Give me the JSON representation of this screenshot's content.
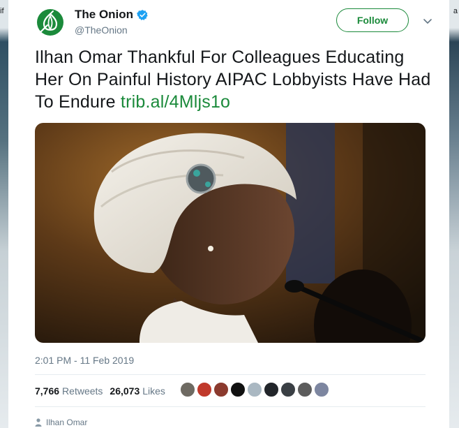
{
  "background": {
    "left_text": "if",
    "right_text": "a"
  },
  "tweet": {
    "display_name": "The Onion",
    "handle": "@TheOnion",
    "follow_label": "Follow",
    "text": "Ilhan Omar Thankful For Colleagues Educating Her On Painful History AIPAC Lobbyists Have Had To Endure",
    "link": "trib.al/4Mljs1o",
    "timestamp": "2:01 PM - 11 Feb 2019",
    "retweets_count": "7,766",
    "retweets_label": "Retweets",
    "likes_count": "26,073",
    "likes_label": "Likes",
    "mentioned_user": "Ilhan Omar"
  },
  "colors": {
    "brand_green": "#1b8a3b",
    "verified_blue": "#1da1f2",
    "text_primary": "#14171a",
    "text_secondary": "#657786"
  },
  "icons": [
    "onion-logo-icon",
    "verified-badge-icon",
    "chevron-down-icon",
    "person-icon"
  ],
  "liker_avatars": [
    {
      "name": "liker-avatar-1",
      "color": "#6e6a62"
    },
    {
      "name": "liker-avatar-2",
      "color": "#c0392b"
    },
    {
      "name": "liker-avatar-3",
      "color": "#8b3a2e"
    },
    {
      "name": "liker-avatar-4",
      "color": "#111111"
    },
    {
      "name": "liker-avatar-5",
      "color": "#aab8c2"
    },
    {
      "name": "liker-avatar-6",
      "color": "#22252a"
    },
    {
      "name": "liker-avatar-7",
      "color": "#3a3f44"
    },
    {
      "name": "liker-avatar-8",
      "color": "#5c5c5c"
    },
    {
      "name": "liker-avatar-9",
      "color": "#7d86a0"
    }
  ]
}
